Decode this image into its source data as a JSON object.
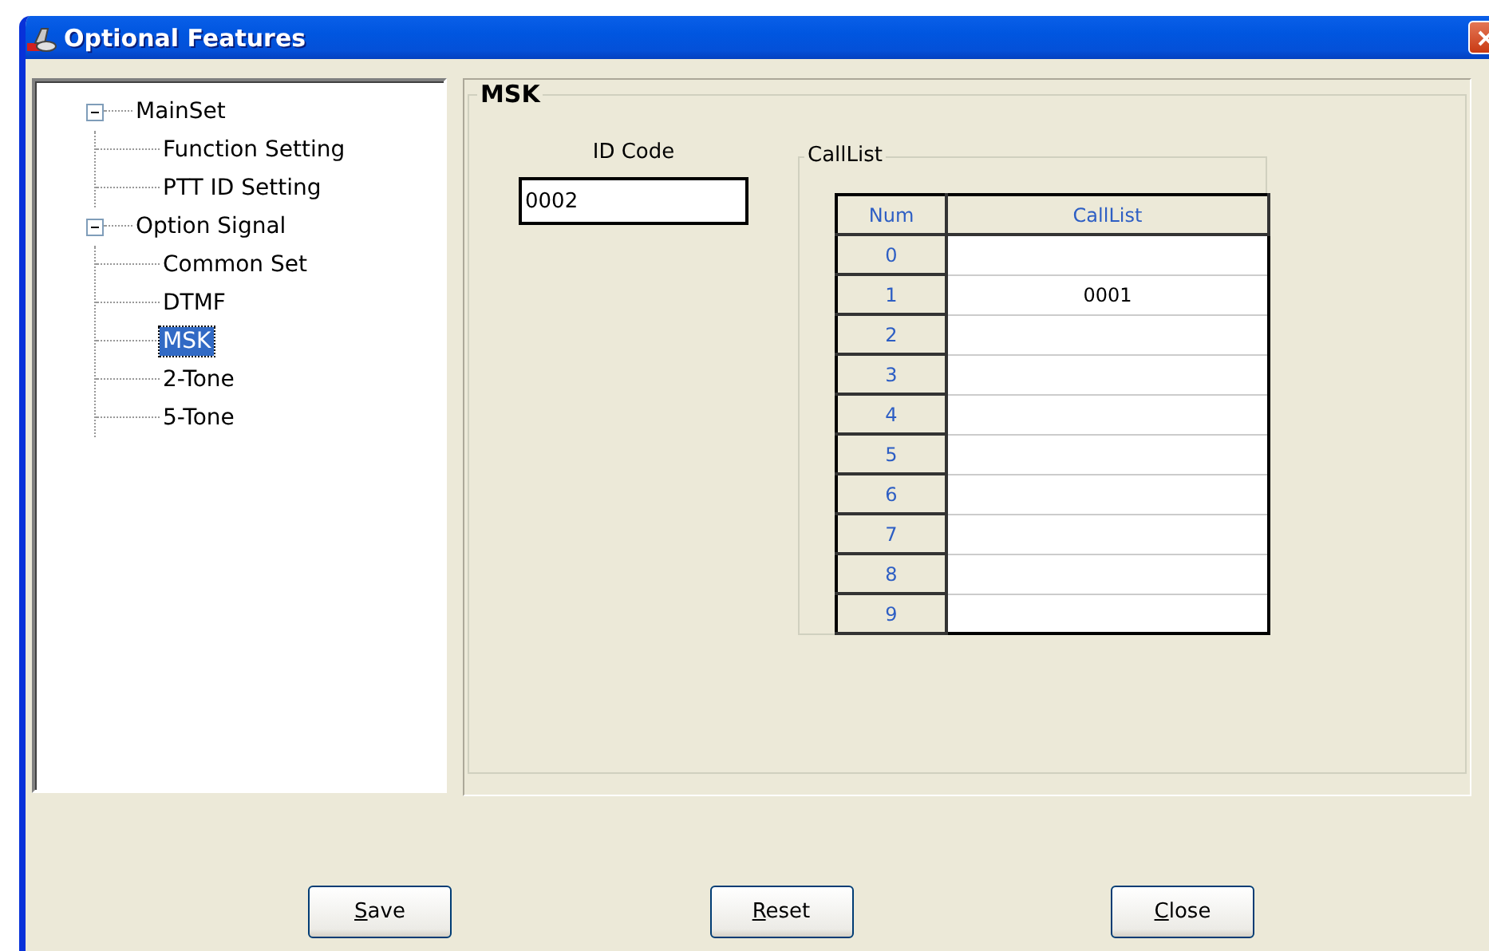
{
  "window": {
    "title": "Optional Features"
  },
  "tree": [
    {
      "label": "MainSet",
      "expanded": true,
      "selected": false,
      "children": [
        {
          "label": "Function Setting",
          "selected": false
        },
        {
          "label": "PTT ID Setting",
          "selected": false
        }
      ]
    },
    {
      "label": "Option Signal",
      "expanded": true,
      "selected": false,
      "children": [
        {
          "label": "Common Set",
          "selected": false
        },
        {
          "label": "DTMF",
          "selected": false
        },
        {
          "label": "MSK",
          "selected": true
        },
        {
          "label": "2-Tone",
          "selected": false
        },
        {
          "label": "5-Tone",
          "selected": false
        }
      ]
    }
  ],
  "panel": {
    "title": "MSK",
    "id_code": {
      "label": "ID Code",
      "value": "0002"
    },
    "call_list": {
      "title": "CallList",
      "columns": [
        "Num",
        "CallList"
      ],
      "rows": [
        {
          "num": "0"
        },
        {
          "num": "1",
          "call": "0001"
        },
        {
          "num": "2"
        },
        {
          "num": "3"
        },
        {
          "num": "4"
        },
        {
          "num": "5"
        },
        {
          "num": "6"
        },
        {
          "num": "7"
        },
        {
          "num": "8"
        },
        {
          "num": "9"
        }
      ]
    }
  },
  "buttons": [
    {
      "label": "Save",
      "mnemonic": true
    },
    {
      "label": "Reset",
      "mnemonic": true
    },
    {
      "label": "Close",
      "mnemonic": true
    }
  ]
}
